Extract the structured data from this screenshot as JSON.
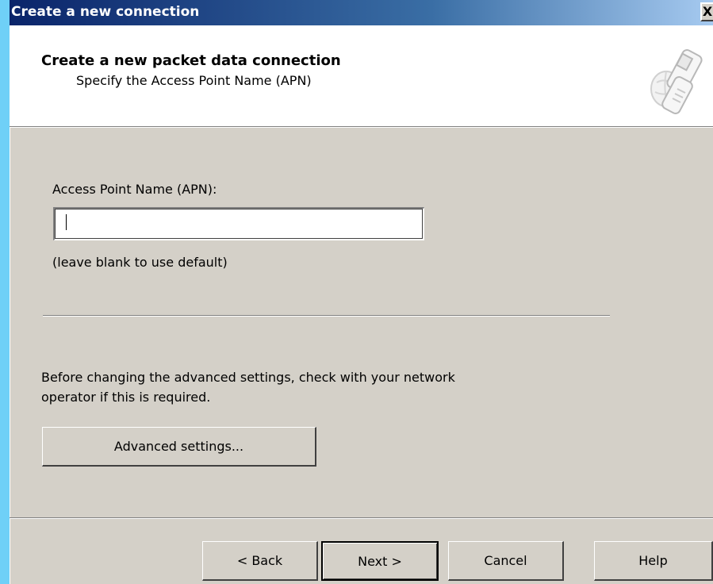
{
  "window": {
    "title": "Create a new connection",
    "close_label": "X"
  },
  "header": {
    "title": "Create a new packet data connection",
    "subtitle": "Specify the Access Point Name (APN)",
    "icon": "mobile-phone-icon"
  },
  "apn": {
    "label": "Access Point Name (APN):",
    "value": "",
    "hint": "(leave blank to use default)"
  },
  "advanced": {
    "advice_line1": "Before changing the advanced settings, check with your network",
    "advice_line2": "operator if this is required.",
    "button_label": "Advanced settings..."
  },
  "footer": {
    "back_label": "< Back",
    "next_label": "Next >",
    "cancel_label": "Cancel",
    "help_label": "Help"
  },
  "colors": {
    "dialog_face": "#d4d0c8",
    "titlebar_start": "#0a246a",
    "titlebar_end": "#a6caf0",
    "desktop": "#6fd0f7"
  }
}
